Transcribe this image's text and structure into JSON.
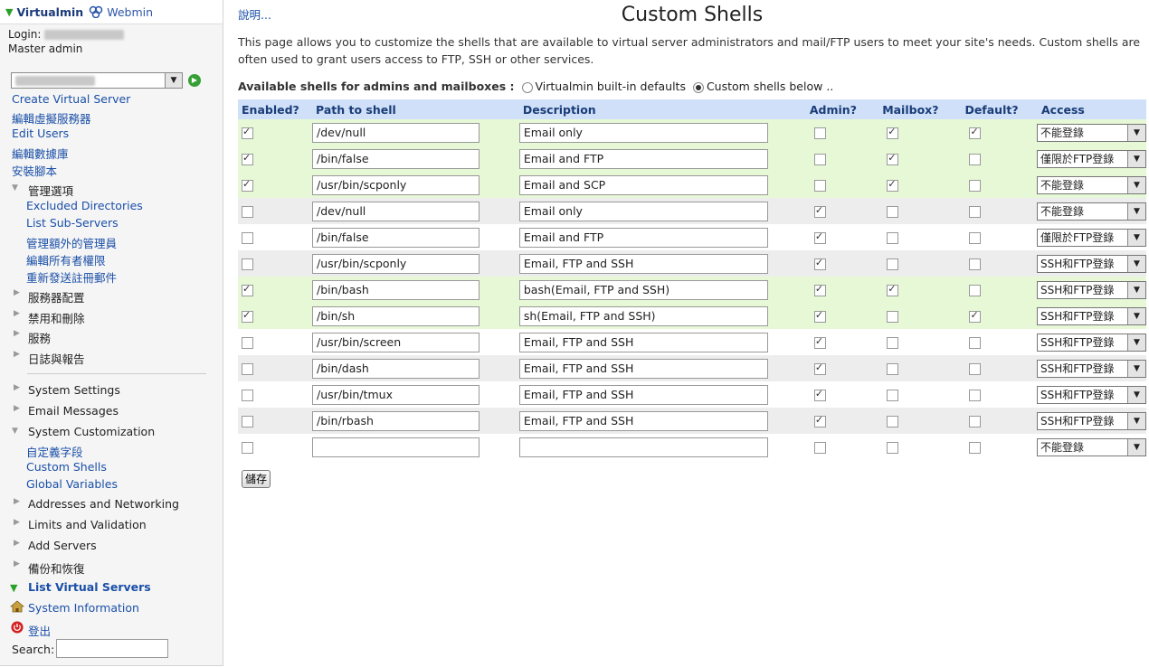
{
  "sidebar": {
    "brand": "Virtualmin",
    "webmin": "Webmin",
    "login_label": "Login:",
    "user_role": "Master admin",
    "links": [
      {
        "label": "Create Virtual Server"
      },
      {
        "label": "編輯虛擬服務器"
      },
      {
        "label": "Edit Users"
      },
      {
        "label": "編輯數據庫"
      },
      {
        "label": "安裝腳本"
      }
    ],
    "admin_options": {
      "label": "管理選項",
      "items": [
        "Excluded Directories",
        "List Sub-Servers",
        "管理額外的管理員",
        "編輯所有者權限",
        "重新發送註冊郵件"
      ]
    },
    "categories_a": [
      "服務器配置",
      "禁用和刪除",
      "服務",
      "日誌與報告"
    ],
    "categories_b": [
      "System Settings",
      "Email Messages"
    ],
    "sys_custom": {
      "label": "System Customization",
      "items": [
        "自定義字段",
        "Custom Shells",
        "Global Variables"
      ]
    },
    "categories_c": [
      "Addresses and Networking",
      "Limits and Validation",
      "Add Servers",
      "備份和恢復"
    ],
    "list_virtual_servers": "List Virtual Servers",
    "system_information": "System Information",
    "logout": "登出",
    "search_label": "Search:"
  },
  "main": {
    "help_link": "說明...",
    "title": "Custom Shells",
    "intro": "This page allows you to customize the shells that are available to virtual server administrators and mail/FTP users to meet your site's needs. Custom shells are often used to grant users access to FTP, SSH or other services.",
    "avail_label": "Available shells for admins and mailboxes :",
    "opt_builtin": "Virtualmin built-in defaults",
    "opt_custom": "Custom shells below ..",
    "columns": [
      "Enabled?",
      "Path to shell",
      "Description",
      "Admin?",
      "Mailbox?",
      "Default?",
      "Access"
    ],
    "rows": [
      {
        "enabled": true,
        "path": "/dev/null",
        "desc": "Email only",
        "admin": false,
        "mailbox": true,
        "default": true,
        "access": "不能登錄"
      },
      {
        "enabled": true,
        "path": "/bin/false",
        "desc": "Email and FTP",
        "admin": false,
        "mailbox": true,
        "default": false,
        "access": "僅限於FTP登錄"
      },
      {
        "enabled": true,
        "path": "/usr/bin/scponly",
        "desc": "Email and SCP",
        "admin": false,
        "mailbox": true,
        "default": false,
        "access": "不能登錄"
      },
      {
        "enabled": false,
        "path": "/dev/null",
        "desc": "Email only",
        "admin": true,
        "mailbox": false,
        "default": false,
        "access": "不能登錄"
      },
      {
        "enabled": false,
        "path": "/bin/false",
        "desc": "Email and FTP",
        "admin": true,
        "mailbox": false,
        "default": false,
        "access": "僅限於FTP登錄"
      },
      {
        "enabled": false,
        "path": "/usr/bin/scponly",
        "desc": "Email, FTP and SSH",
        "admin": true,
        "mailbox": false,
        "default": false,
        "access": "SSH和FTP登錄"
      },
      {
        "enabled": true,
        "path": "/bin/bash",
        "desc": "bash(Email, FTP and SSH)",
        "admin": true,
        "mailbox": true,
        "default": false,
        "access": "SSH和FTP登錄"
      },
      {
        "enabled": true,
        "path": "/bin/sh",
        "desc": "sh(Email, FTP and SSH)",
        "admin": true,
        "mailbox": false,
        "default": true,
        "access": "SSH和FTP登錄"
      },
      {
        "enabled": false,
        "path": "/usr/bin/screen",
        "desc": "Email, FTP and SSH",
        "admin": true,
        "mailbox": false,
        "default": false,
        "access": "SSH和FTP登錄"
      },
      {
        "enabled": false,
        "path": "/bin/dash",
        "desc": "Email, FTP and SSH",
        "admin": true,
        "mailbox": false,
        "default": false,
        "access": "SSH和FTP登錄"
      },
      {
        "enabled": false,
        "path": "/usr/bin/tmux",
        "desc": "Email, FTP and SSH",
        "admin": true,
        "mailbox": false,
        "default": false,
        "access": "SSH和FTP登錄"
      },
      {
        "enabled": false,
        "path": "/bin/rbash",
        "desc": "Email, FTP and SSH",
        "admin": true,
        "mailbox": false,
        "default": false,
        "access": "SSH和FTP登錄"
      },
      {
        "enabled": false,
        "path": "",
        "desc": "",
        "admin": false,
        "mailbox": false,
        "default": false,
        "access": "不能登錄"
      }
    ],
    "save_label": "儲存"
  }
}
